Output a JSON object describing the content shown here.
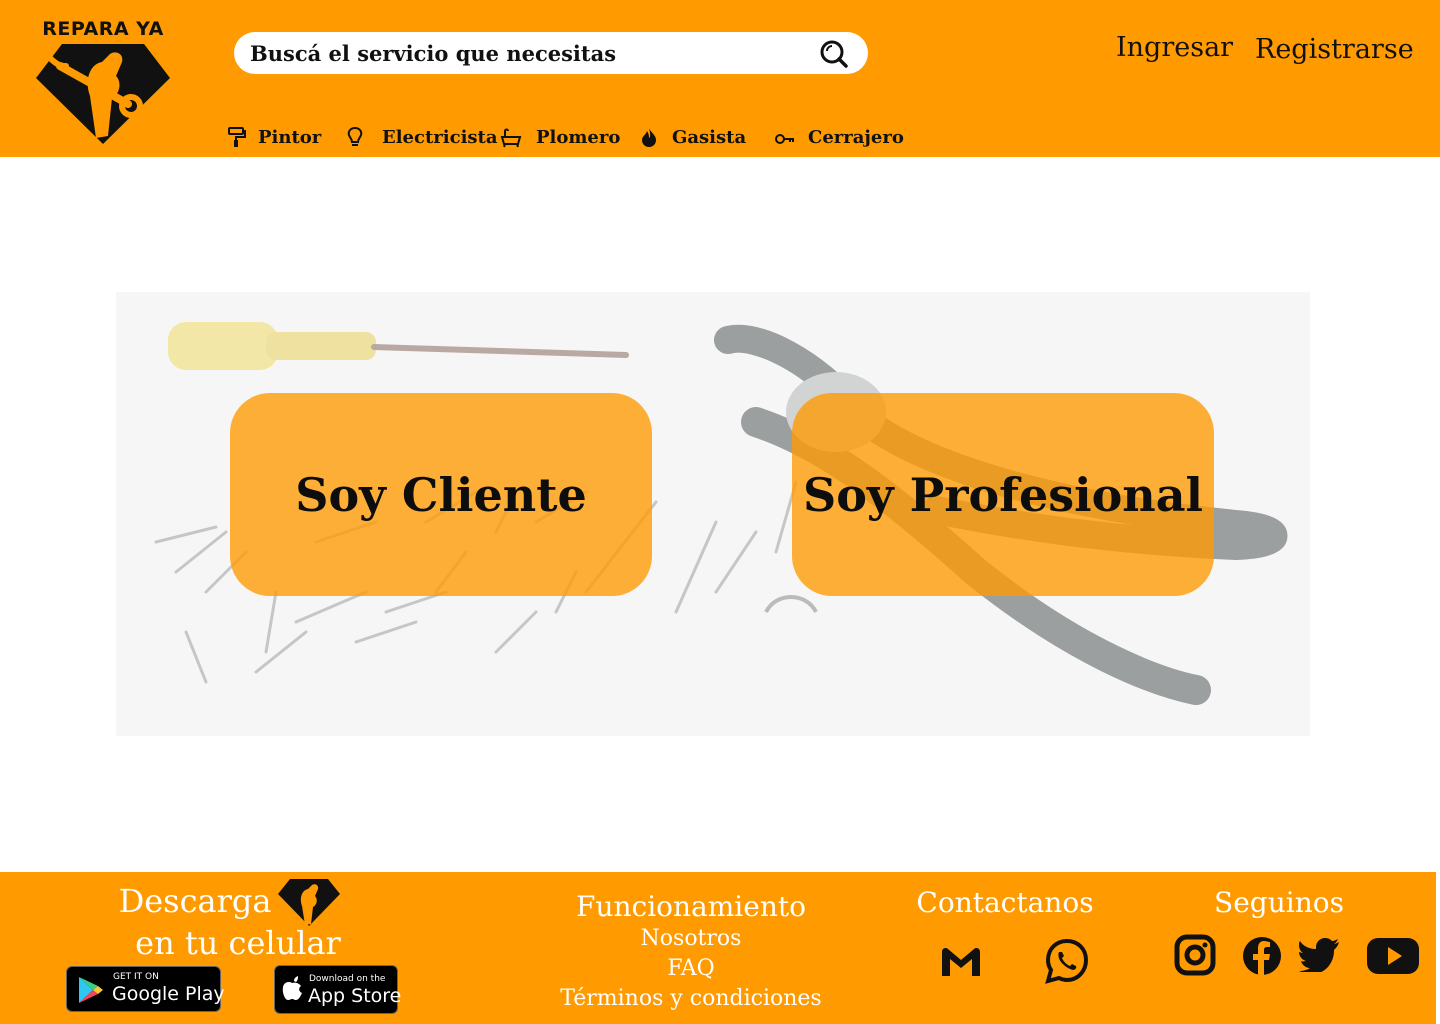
{
  "brand": {
    "name": "REPARA YA"
  },
  "colors": {
    "primary": "#ff9a00",
    "text": "#111111",
    "footer_text": "#ffffff"
  },
  "search": {
    "placeholder": "Buscá el servicio que necesitas",
    "icon": "search-icon"
  },
  "auth": {
    "login_label": "Ingresar",
    "register_label": "Registrarse"
  },
  "categories": [
    {
      "label": "Pintor",
      "icon": "paint-roller-icon"
    },
    {
      "label": "Electricista",
      "icon": "lightbulb-icon"
    },
    {
      "label": "Plomero",
      "icon": "bathtub-icon"
    },
    {
      "label": "Gasista",
      "icon": "flame-icon"
    },
    {
      "label": "Cerrajero",
      "icon": "key-icon"
    }
  ],
  "hero": {
    "client_label": "Soy Cliente",
    "pro_label": "Soy Profesional"
  },
  "footer": {
    "download_line1": "Descarga",
    "download_line2": "en tu celular",
    "google_play": {
      "small": "GET IT ON",
      "big": "Google Play"
    },
    "app_store": {
      "small": "Download on the",
      "big": "App Store"
    },
    "links_title": "Funcionamiento",
    "links": [
      "Nosotros",
      "FAQ",
      "Términos y condiciones"
    ],
    "contact_title": "Contactanos",
    "contact_icons": [
      "gmail-icon",
      "whatsapp-icon"
    ],
    "follow_title": "Seguinos",
    "social_icons": [
      "instagram-icon",
      "facebook-icon",
      "twitter-icon",
      "youtube-icon"
    ]
  }
}
